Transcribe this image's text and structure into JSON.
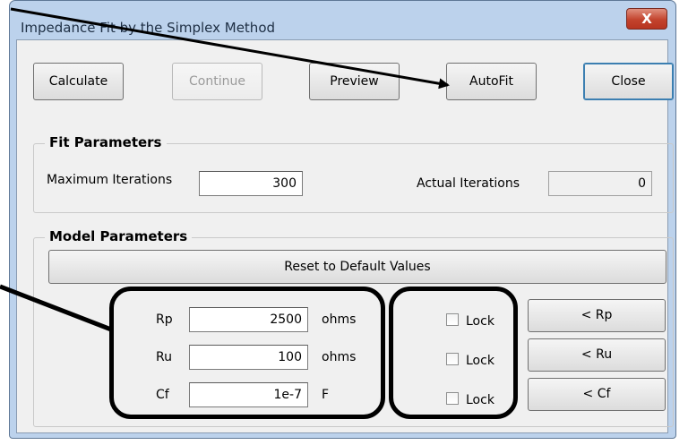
{
  "window": {
    "title": "Impedance Fit by the Simplex Method",
    "close_glyph": "X"
  },
  "toolbar": {
    "calculate": "Calculate",
    "continue": "Continue",
    "preview": "Preview",
    "autofit": "AutoFit",
    "close": "Close"
  },
  "fit_parameters": {
    "title": "Fit Parameters",
    "max_iterations_label": "Maximum Iterations",
    "max_iterations_value": "300",
    "actual_iterations_label": "Actual Iterations",
    "actual_iterations_value": "0"
  },
  "model_parameters": {
    "title": "Model Parameters",
    "reset_label": "Reset to Default Values",
    "rows": [
      {
        "name": "Rp",
        "value": "2500",
        "unit": "ohms",
        "lock": "Lock",
        "button": "< Rp"
      },
      {
        "name": "Ru",
        "value": "100",
        "unit": "ohms",
        "lock": "Lock",
        "button": "< Ru"
      },
      {
        "name": "Cf",
        "value": "1e-7",
        "unit": "F",
        "lock": "Lock",
        "button": "< Cf"
      }
    ]
  },
  "colors": {
    "annotation": "#000000",
    "close_button": "#c3432d"
  }
}
